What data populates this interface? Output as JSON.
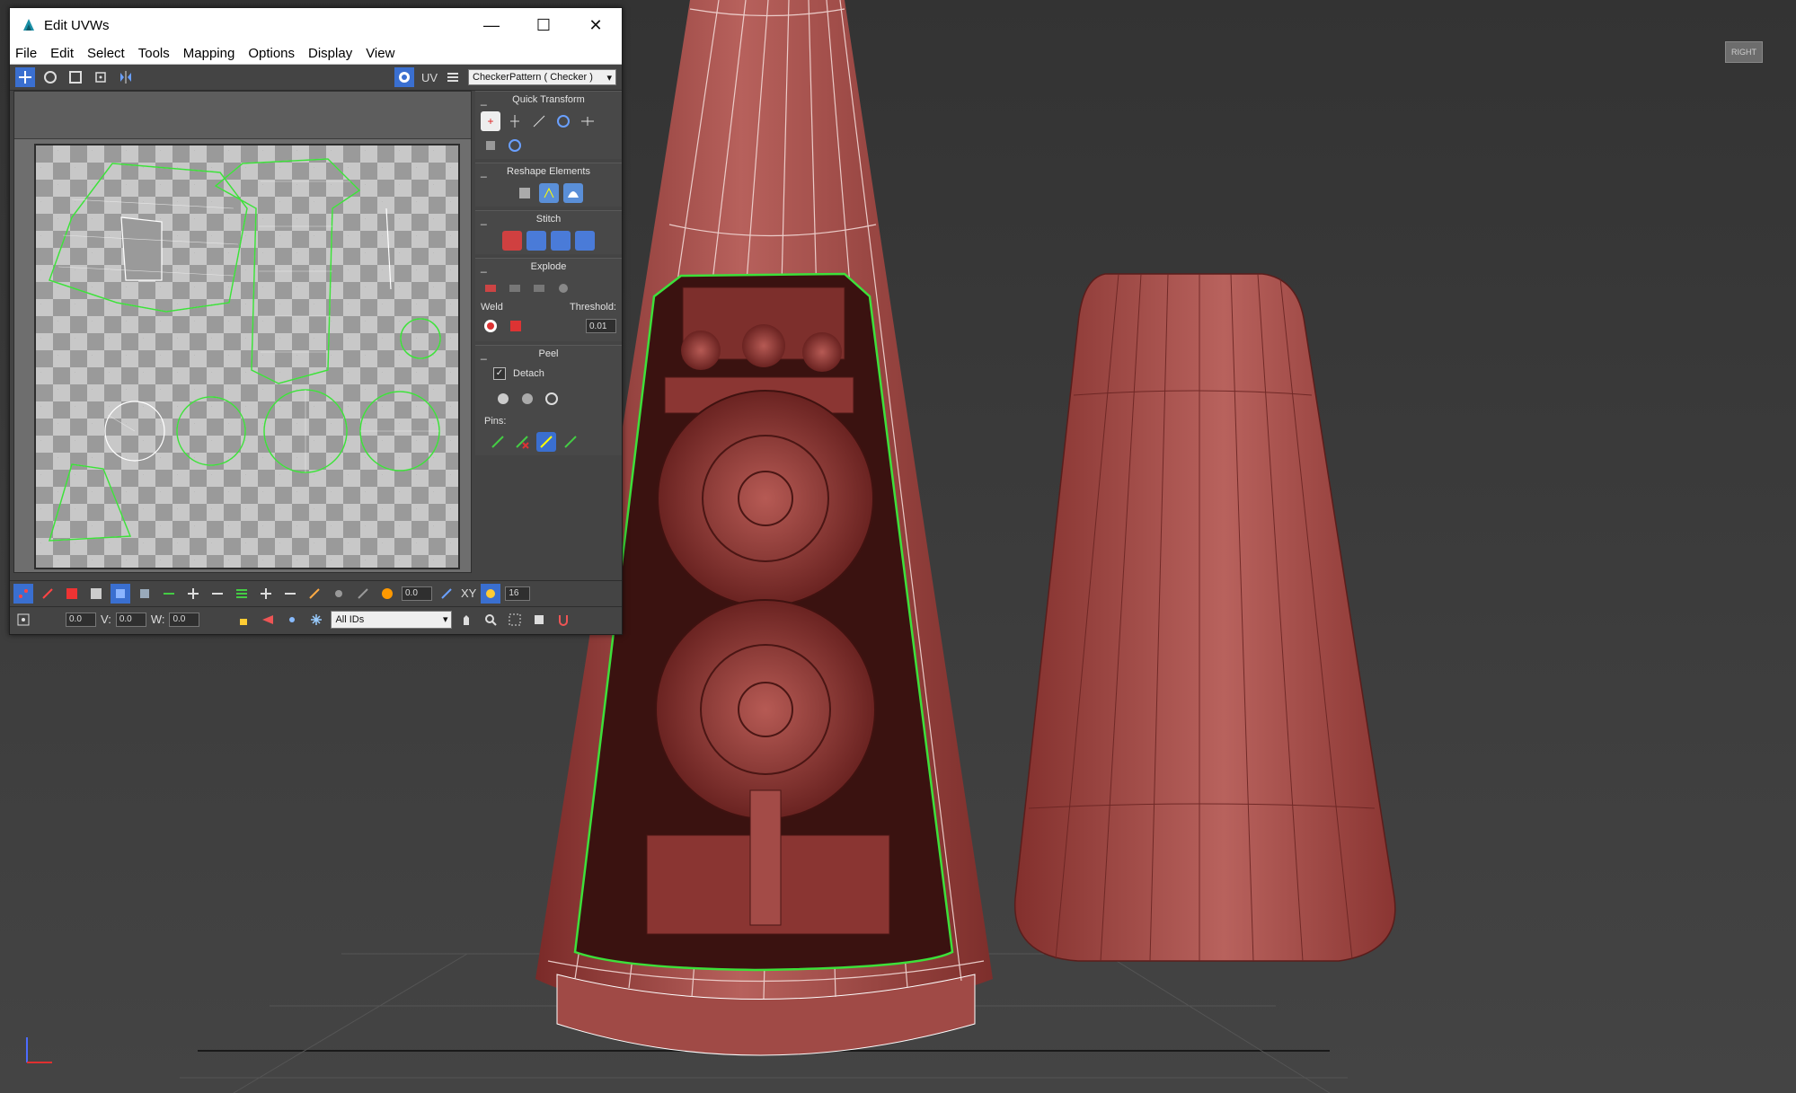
{
  "window": {
    "title": "Edit UVWs",
    "controls": {
      "minimize": "—",
      "maximize": "☐",
      "close": "✕"
    }
  },
  "menu": [
    "File",
    "Edit",
    "Select",
    "Tools",
    "Mapping",
    "Options",
    "Display",
    "View"
  ],
  "toolbar": {
    "uv_label": "UV",
    "texture_dropdown": "CheckerPattern  ( Checker )",
    "icons": [
      "move-icon",
      "rotate-icon",
      "scale-icon",
      "freeform-icon",
      "mirror-icon",
      "show-map-icon",
      "texture-list-icon"
    ]
  },
  "rollouts": {
    "quick_transform": {
      "title": "Quick Transform"
    },
    "reshape_elements": {
      "title": "Reshape Elements"
    },
    "stitch": {
      "title": "Stitch"
    },
    "explode": {
      "title": "Explode",
      "weld_label": "Weld",
      "threshold_label": "Threshold:",
      "threshold_value": "0.01"
    },
    "peel": {
      "title": "Peel",
      "detach_label": "Detach",
      "detach_checked": true,
      "pins_label": "Pins:"
    }
  },
  "bottom_bar1": {
    "spinner_value": "0.0",
    "axis_label": "XY",
    "count_value": "16"
  },
  "bottom_bar2": {
    "u_value": "0.0",
    "v_label": "V:",
    "v_value": "0.0",
    "w_label": "W:",
    "w_value": "0.0",
    "ids_dropdown": "All IDs"
  },
  "viewport": {
    "viewcube_label": "RIGHT",
    "model_color": "#9e3f3c",
    "seam_color": "#38e03a"
  }
}
